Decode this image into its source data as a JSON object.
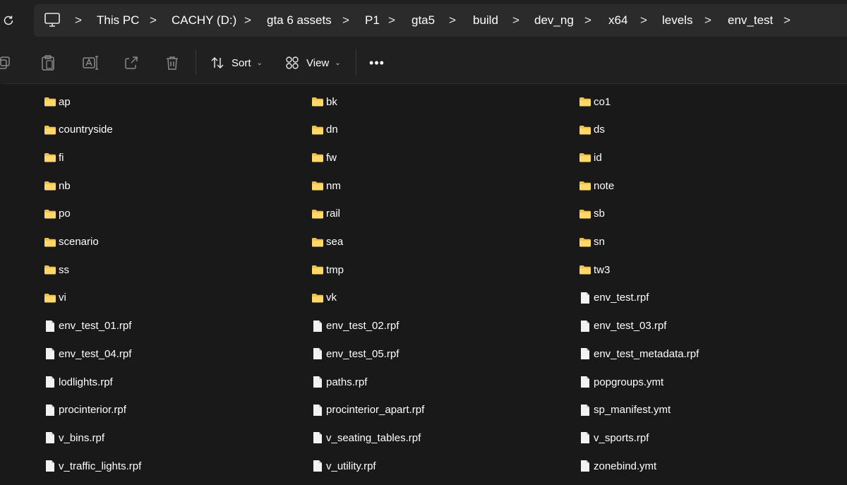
{
  "address": {
    "breadcrumbs": [
      "This PC",
      "CACHY (D:)",
      "gta 6 assets",
      "P1",
      "gta5",
      "build",
      "dev_ng",
      "x64",
      "levels",
      "env_test"
    ]
  },
  "toolbar": {
    "sort_label": "Sort",
    "view_label": "View",
    "more_label": "•••"
  },
  "files": {
    "columns": [
      [
        {
          "name": "ap",
          "type": "folder"
        },
        {
          "name": "countryside",
          "type": "folder"
        },
        {
          "name": "fi",
          "type": "folder"
        },
        {
          "name": "nb",
          "type": "folder"
        },
        {
          "name": "po",
          "type": "folder"
        },
        {
          "name": "scenario",
          "type": "folder"
        },
        {
          "name": "ss",
          "type": "folder"
        },
        {
          "name": "vi",
          "type": "folder"
        },
        {
          "name": "env_test_01.rpf",
          "type": "file"
        },
        {
          "name": "env_test_04.rpf",
          "type": "file"
        },
        {
          "name": "lodlights.rpf",
          "type": "file"
        },
        {
          "name": "procinterior.rpf",
          "type": "file"
        },
        {
          "name": "v_bins.rpf",
          "type": "file"
        },
        {
          "name": "v_traffic_lights.rpf",
          "type": "file"
        }
      ],
      [
        {
          "name": "bk",
          "type": "folder"
        },
        {
          "name": "dn",
          "type": "folder"
        },
        {
          "name": "fw",
          "type": "folder"
        },
        {
          "name": "nm",
          "type": "folder"
        },
        {
          "name": "rail",
          "type": "folder"
        },
        {
          "name": "sea",
          "type": "folder"
        },
        {
          "name": "tmp",
          "type": "folder"
        },
        {
          "name": "vk",
          "type": "folder"
        },
        {
          "name": "env_test_02.rpf",
          "type": "file"
        },
        {
          "name": "env_test_05.rpf",
          "type": "file"
        },
        {
          "name": "paths.rpf",
          "type": "file"
        },
        {
          "name": "procinterior_apart.rpf",
          "type": "file"
        },
        {
          "name": "v_seating_tables.rpf",
          "type": "file"
        },
        {
          "name": "v_utility.rpf",
          "type": "file"
        }
      ],
      [
        {
          "name": "co1",
          "type": "folder"
        },
        {
          "name": "ds",
          "type": "folder"
        },
        {
          "name": "id",
          "type": "folder"
        },
        {
          "name": "note",
          "type": "folder"
        },
        {
          "name": "sb",
          "type": "folder"
        },
        {
          "name": "sn",
          "type": "folder"
        },
        {
          "name": "tw3",
          "type": "folder"
        },
        {
          "name": "env_test.rpf",
          "type": "file"
        },
        {
          "name": "env_test_03.rpf",
          "type": "file"
        },
        {
          "name": "env_test_metadata.rpf",
          "type": "file"
        },
        {
          "name": "popgroups.ymt",
          "type": "file"
        },
        {
          "name": "sp_manifest.ymt",
          "type": "file"
        },
        {
          "name": "v_sports.rpf",
          "type": "file"
        },
        {
          "name": "zonebind.ymt",
          "type": "file"
        }
      ]
    ]
  },
  "colors": {
    "background": "#191919",
    "chrome": "#202020",
    "folder": "#f4c24a",
    "folder_light": "#ffd86b",
    "file": "#f2f2f2"
  },
  "icons": {
    "refresh": "refresh-icon",
    "pc": "monitor-icon",
    "copy": "copy-icon",
    "paste": "paste-icon",
    "rename": "rename-icon",
    "share": "share-icon",
    "delete": "trash-icon",
    "sort": "sort-icon",
    "view": "view-icon",
    "folder": "folder-icon",
    "file": "file-icon"
  }
}
